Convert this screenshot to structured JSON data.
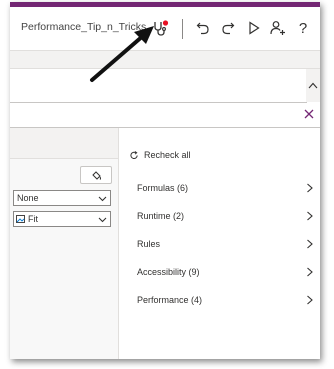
{
  "app": {
    "title": "Performance_Tip_n_Tricks"
  },
  "toolbar": {
    "icons": [
      "app-checker-icon",
      "undo-icon",
      "redo-icon",
      "play-icon",
      "share-icon",
      "help-icon"
    ],
    "help_label": "?"
  },
  "properties": {
    "dropdown1_value": "None",
    "dropdown2_value": "Fit"
  },
  "checker": {
    "recheck_label": "Recheck all",
    "categories": [
      {
        "label": "Formulas (6)"
      },
      {
        "label": "Runtime (2)"
      },
      {
        "label": "Rules"
      },
      {
        "label": "Accessibility (9)"
      },
      {
        "label": "Performance (4)"
      }
    ]
  },
  "colors": {
    "brand": "#742774",
    "badge": "#e81123",
    "text": "#323130"
  }
}
